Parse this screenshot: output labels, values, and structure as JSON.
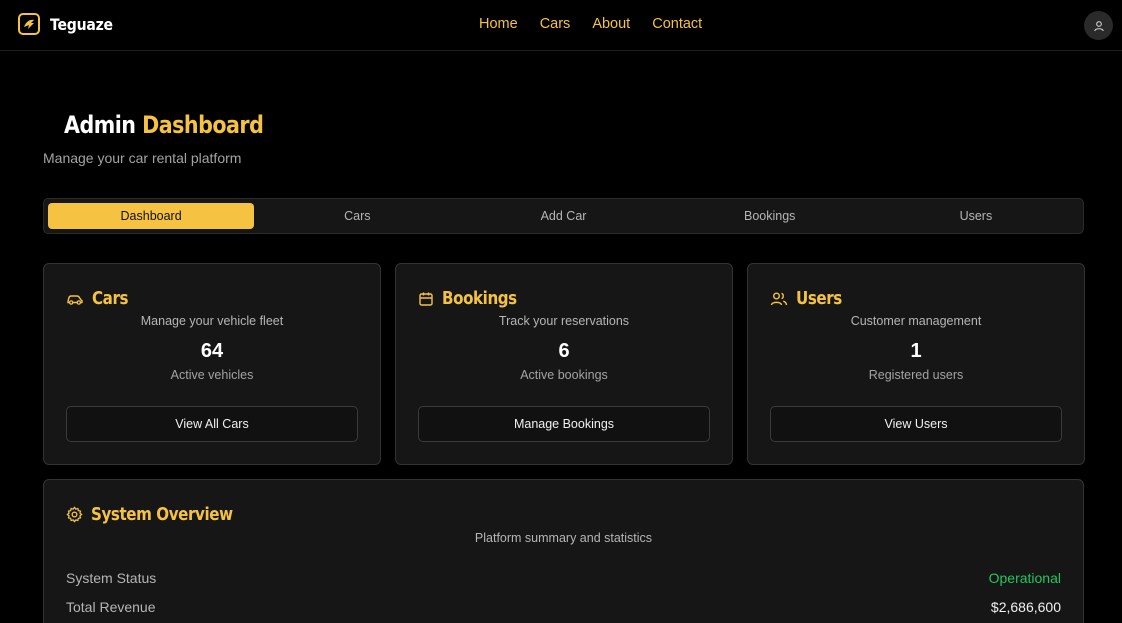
{
  "header": {
    "brand": "Teguaze",
    "nav": [
      "Home",
      "Cars",
      "About",
      "Contact"
    ]
  },
  "page": {
    "title_part1": "Admin",
    "title_part2": "Dashboard",
    "subtitle": "Manage your car rental platform"
  },
  "tabs": [
    "Dashboard",
    "Cars",
    "Add Car",
    "Bookings",
    "Users"
  ],
  "active_tab": "Dashboard",
  "cards": [
    {
      "icon": "car-icon",
      "title": "Cars",
      "desc": "Manage your vehicle fleet",
      "count": "64",
      "label": "Active vehicles",
      "button": "View All Cars"
    },
    {
      "icon": "calendar-icon",
      "title": "Bookings",
      "desc": "Track your reservations",
      "count": "6",
      "label": "Active bookings",
      "button": "Manage Bookings"
    },
    {
      "icon": "users-icon",
      "title": "Users",
      "desc": "Customer management",
      "count": "1",
      "label": "Registered users",
      "button": "View Users"
    }
  ],
  "overview": {
    "icon": "gear-icon",
    "title": "System Overview",
    "desc": "Platform summary and statistics",
    "rows": [
      {
        "key": "System Status",
        "value": "Operational"
      },
      {
        "key": "Total Revenue",
        "value": "$2,686,600"
      }
    ]
  },
  "colors": {
    "accent": "#f5c242",
    "status_ok": "#22c55e",
    "background": "#000000",
    "card": "#161617"
  }
}
